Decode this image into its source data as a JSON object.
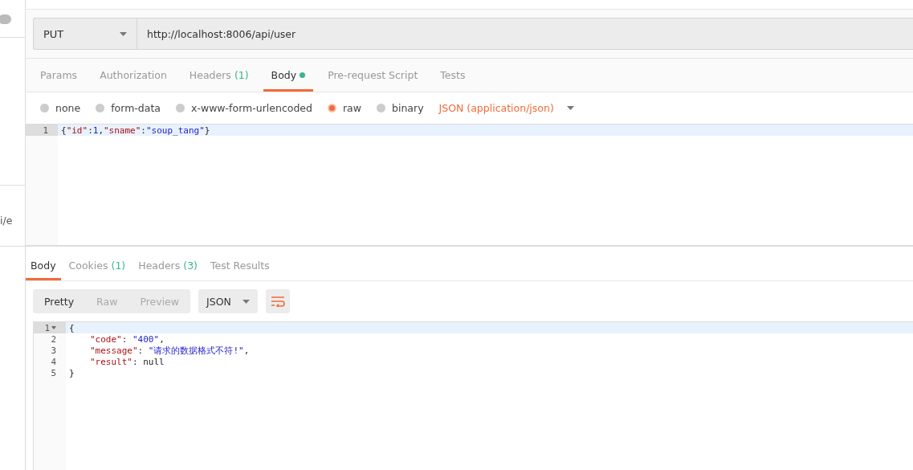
{
  "sidebar": {
    "toggle": {
      "on": false
    },
    "fragment": "i/e"
  },
  "request": {
    "method": "PUT",
    "url": "http://localhost:8006/api/user"
  },
  "request_tabs": [
    {
      "label": "Params",
      "dot": false,
      "selected": false
    },
    {
      "label": "Authorization",
      "dot": false,
      "selected": false
    },
    {
      "label": "Headers",
      "count": "(1)",
      "dot": false,
      "selected": false
    },
    {
      "label": "Body",
      "dot": true,
      "selected": true
    },
    {
      "label": "Pre-request Script",
      "dot": false,
      "selected": false
    },
    {
      "label": "Tests",
      "dot": false,
      "selected": false
    }
  ],
  "body_modes": [
    {
      "label": "none",
      "selected": false
    },
    {
      "label": "form-data",
      "selected": false
    },
    {
      "label": "x-www-form-urlencoded",
      "selected": false
    },
    {
      "label": "raw",
      "selected": true
    },
    {
      "label": "binary",
      "selected": false
    }
  ],
  "content_type": "JSON (application/json)",
  "request_editor": {
    "lines": [
      {
        "number": "1",
        "active": true,
        "tokens": [
          {
            "kind": "punct",
            "text": "{"
          },
          {
            "kind": "key",
            "text": "\"id\""
          },
          {
            "kind": "punct",
            "text": ":"
          },
          {
            "kind": "number",
            "text": "1"
          },
          {
            "kind": "punct",
            "text": ","
          },
          {
            "kind": "key",
            "text": "\"sname\""
          },
          {
            "kind": "punct",
            "text": ":"
          },
          {
            "kind": "string",
            "text": "\"soup_tang\""
          },
          {
            "kind": "punct",
            "text": "}"
          }
        ]
      }
    ]
  },
  "response_tabs": [
    {
      "label": "Body",
      "selected": true
    },
    {
      "label": "Cookies",
      "count": "(1)",
      "selected": false
    },
    {
      "label": "Headers",
      "count": "(3)",
      "selected": false
    },
    {
      "label": "Test Results",
      "selected": false
    }
  ],
  "view_modes": [
    {
      "label": "Pretty",
      "selected": true
    },
    {
      "label": "Raw",
      "selected": false
    },
    {
      "label": "Preview",
      "selected": false
    }
  ],
  "format": "JSON",
  "response_editor": {
    "lines": [
      {
        "number": "1",
        "active": true,
        "fold": true,
        "tokens": [
          {
            "kind": "punct",
            "text": "{"
          }
        ]
      },
      {
        "number": "2",
        "active": false,
        "indented": true,
        "tokens": [
          {
            "kind": "key",
            "text": "\"code\""
          },
          {
            "kind": "punct",
            "text": ": "
          },
          {
            "kind": "string",
            "text": "\"400\""
          },
          {
            "kind": "punct",
            "text": ","
          }
        ]
      },
      {
        "number": "3",
        "active": false,
        "indented": true,
        "tokens": [
          {
            "kind": "key",
            "text": "\"message\""
          },
          {
            "kind": "punct",
            "text": ": "
          },
          {
            "kind": "string",
            "text": "\"请求的数据格式不符!\""
          },
          {
            "kind": "punct",
            "text": ","
          }
        ]
      },
      {
        "number": "4",
        "active": false,
        "indented": true,
        "tokens": [
          {
            "kind": "key",
            "text": "\"result\""
          },
          {
            "kind": "punct",
            "text": ": "
          },
          {
            "kind": "punct",
            "text": "null"
          }
        ]
      },
      {
        "number": "5",
        "active": false,
        "tokens": [
          {
            "kind": "punct",
            "text": "}"
          }
        ]
      }
    ]
  }
}
